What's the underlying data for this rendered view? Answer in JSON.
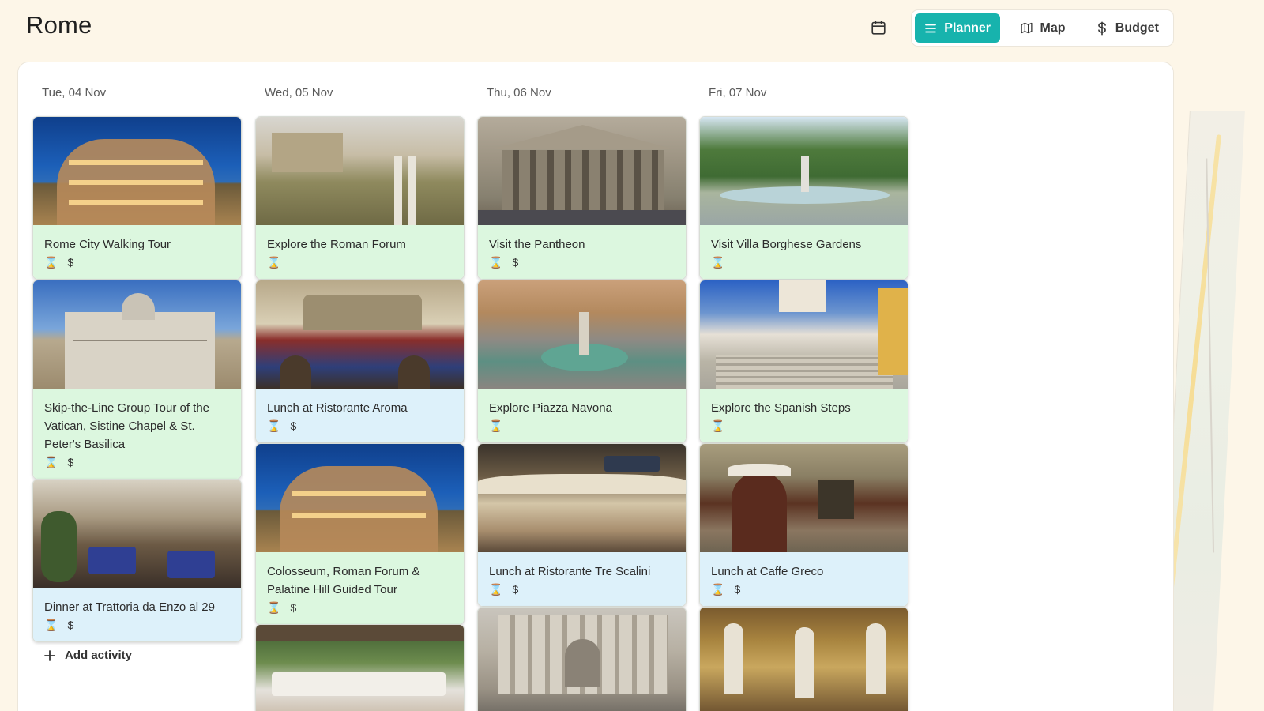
{
  "header": {
    "title": "Rome",
    "calendar_icon": "calendar-icon",
    "views": [
      {
        "label": "Planner",
        "icon": "list-icon",
        "active": true
      },
      {
        "label": "Map",
        "icon": "map-icon",
        "active": false
      },
      {
        "label": "Budget",
        "icon": "dollar-icon",
        "active": false
      }
    ]
  },
  "colors": {
    "accent": "#17b3ad",
    "activity_card": "#dcf7df",
    "meal_card": "#ddf1fa",
    "background": "#fdf6e8"
  },
  "days": [
    {
      "label": "Tue, 04 Nov",
      "cards": [
        {
          "title": "Rome City Walking Tour",
          "type": "activity",
          "duration_icon": "hourglass-icon",
          "cost_icon": "$"
        },
        {
          "title": "Skip-the-Line Group Tour of the Vatican, Sistine Chapel & St. Peter's Basilica",
          "type": "activity",
          "duration_icon": "hourglass-icon",
          "cost_icon": "$"
        },
        {
          "title": "Dinner at Trattoria da Enzo al 29",
          "type": "meal",
          "duration_icon": "hourglass-icon",
          "cost_icon": "$"
        }
      ]
    },
    {
      "label": "Wed, 05 Nov",
      "cards": [
        {
          "title": "Explore the Roman Forum",
          "type": "activity",
          "duration_icon": "hourglass-icon"
        },
        {
          "title": "Lunch at Ristorante Aroma",
          "type": "meal",
          "duration_icon": "hourglass-icon",
          "cost_icon": "$"
        },
        {
          "title": "Colosseum, Roman Forum & Palatine Hill Guided Tour",
          "type": "activity",
          "duration_icon": "hourglass-icon",
          "cost_icon": "$"
        }
      ]
    },
    {
      "label": "Thu, 06 Nov",
      "cards": [
        {
          "title": "Visit the Pantheon",
          "type": "activity",
          "duration_icon": "hourglass-icon",
          "cost_icon": "$"
        },
        {
          "title": "Explore Piazza Navona",
          "type": "activity",
          "duration_icon": "hourglass-icon"
        },
        {
          "title": "Lunch at Ristorante Tre Scalini",
          "type": "meal",
          "duration_icon": "hourglass-icon",
          "cost_icon": "$"
        }
      ]
    },
    {
      "label": "Fri, 07 Nov",
      "cards": [
        {
          "title": "Visit Villa Borghese Gardens",
          "type": "activity",
          "duration_icon": "hourglass-icon"
        },
        {
          "title": "Explore the Spanish Steps",
          "type": "activity",
          "duration_icon": "hourglass-icon"
        },
        {
          "title": "Lunch at Caffe Greco",
          "type": "meal",
          "duration_icon": "hourglass-icon",
          "cost_icon": "$"
        }
      ]
    }
  ],
  "add_activity_label": "Add activity"
}
